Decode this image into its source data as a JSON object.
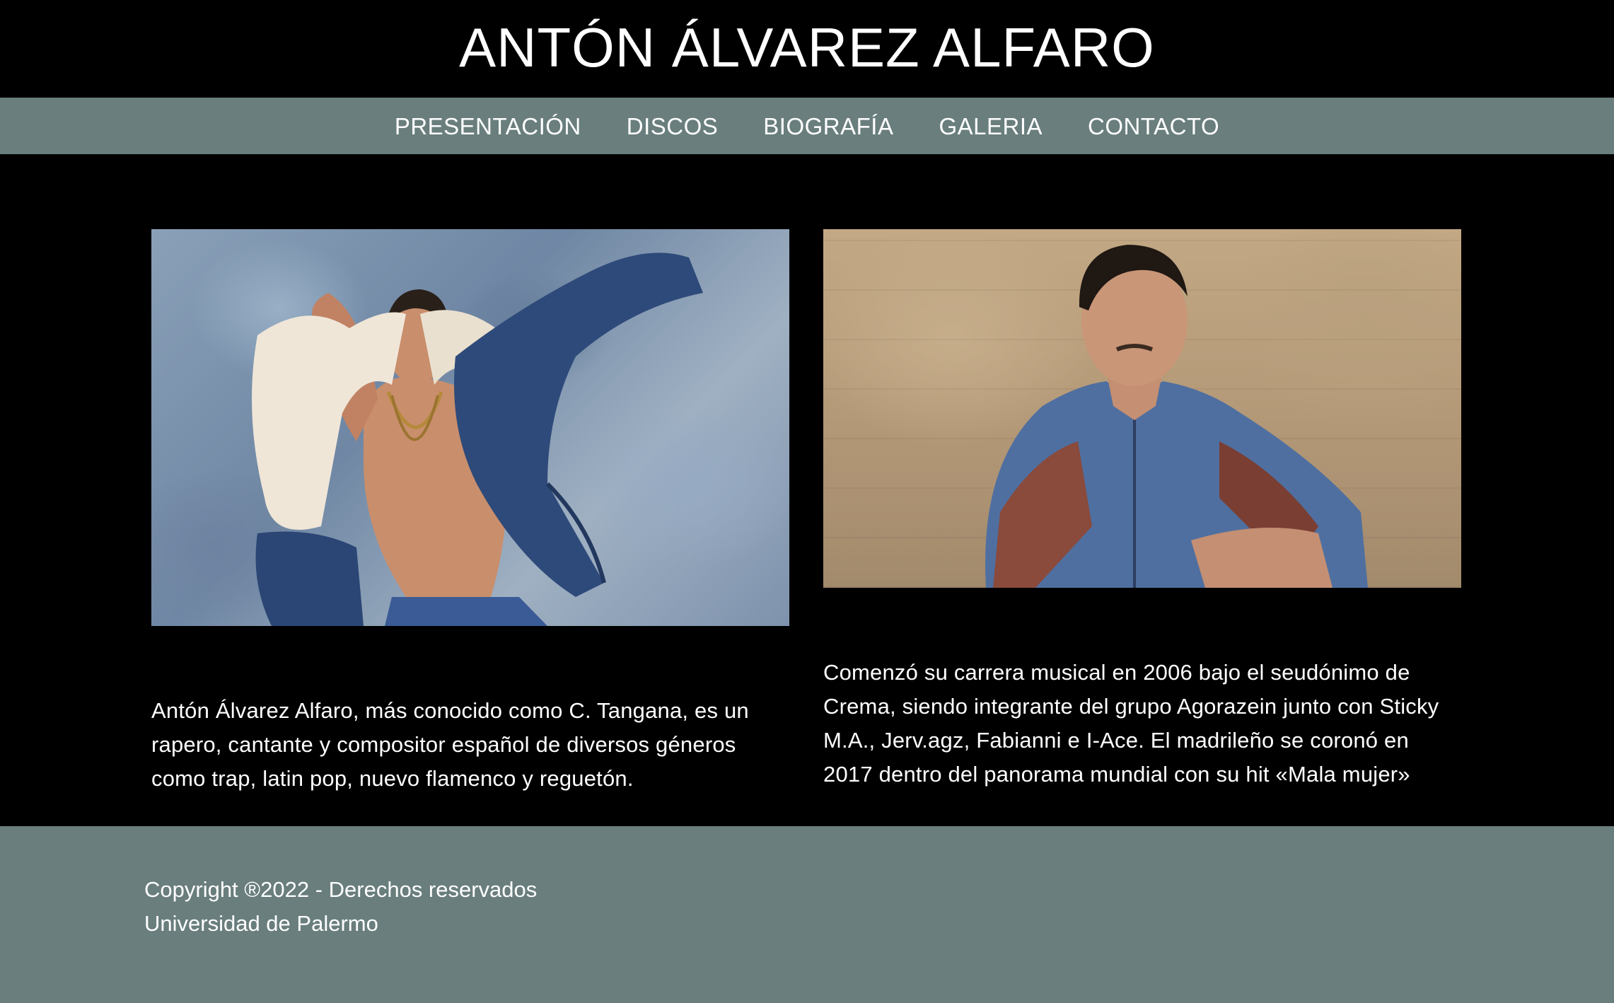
{
  "header": {
    "title": "ANTÓN ÁLVAREZ ALFARO"
  },
  "nav": {
    "items": [
      {
        "label": "PRESENTACIÓN"
      },
      {
        "label": "DISCOS"
      },
      {
        "label": "BIOGRAFÍA"
      },
      {
        "label": "GALERIA"
      },
      {
        "label": "CONTACTO"
      }
    ]
  },
  "main": {
    "columns": [
      {
        "image": "photo-artist-denim-jacket",
        "text": "Antón Álvarez Alfaro, más conocido como C. Tangana, es un rapero, cantante y compositor español de diversos géneros como trap, latin pop, nuevo flamenco y reguetón."
      },
      {
        "image": "photo-artist-printed-shirt",
        "text": "Comenzó su carrera musical en 2006 bajo el seudónimo de Crema, siendo integrante del grupo Agorazein junto con Sticky M.A., Jerv.agz, Fabianni e I-Ace. El madrileño se coronó en 2017 dentro del panorama mundial con su hit «Mala mujer»"
      }
    ]
  },
  "footer": {
    "copyright": "Copyright ®2022 - Derechos reservados",
    "institution": "Universidad de Palermo"
  },
  "colors": {
    "background": "#000000",
    "accent_bar": "#697e7d",
    "text": "#ffffff"
  }
}
